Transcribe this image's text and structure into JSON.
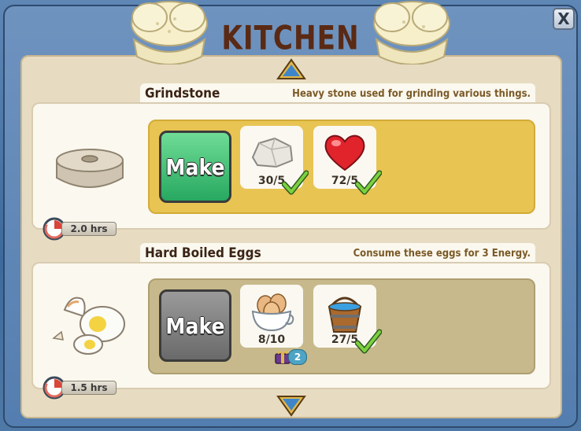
{
  "window": {
    "title": "KITCHEN",
    "close_label": "X"
  },
  "recipes": [
    {
      "name": "Grindstone",
      "description": "Heavy stone used for grinding various things.",
      "make_label": "Make",
      "make_enabled": true,
      "time": "2.0 hrs",
      "ingredients": [
        {
          "icon": "stone-icon",
          "count": "30/5",
          "satisfied": true
        },
        {
          "icon": "heart-icon",
          "count": "72/5",
          "satisfied": true
        }
      ]
    },
    {
      "name": "Hard Boiled Eggs",
      "description": "Consume these eggs for 3 Energy.",
      "make_label": "Make",
      "make_enabled": false,
      "time": "1.5 hrs",
      "ingredients": [
        {
          "icon": "eggs-bowl-icon",
          "count": "8/10",
          "satisfied": false,
          "badge": "2"
        },
        {
          "icon": "water-bucket-icon",
          "count": "27/5",
          "satisfied": true
        }
      ]
    }
  ]
}
